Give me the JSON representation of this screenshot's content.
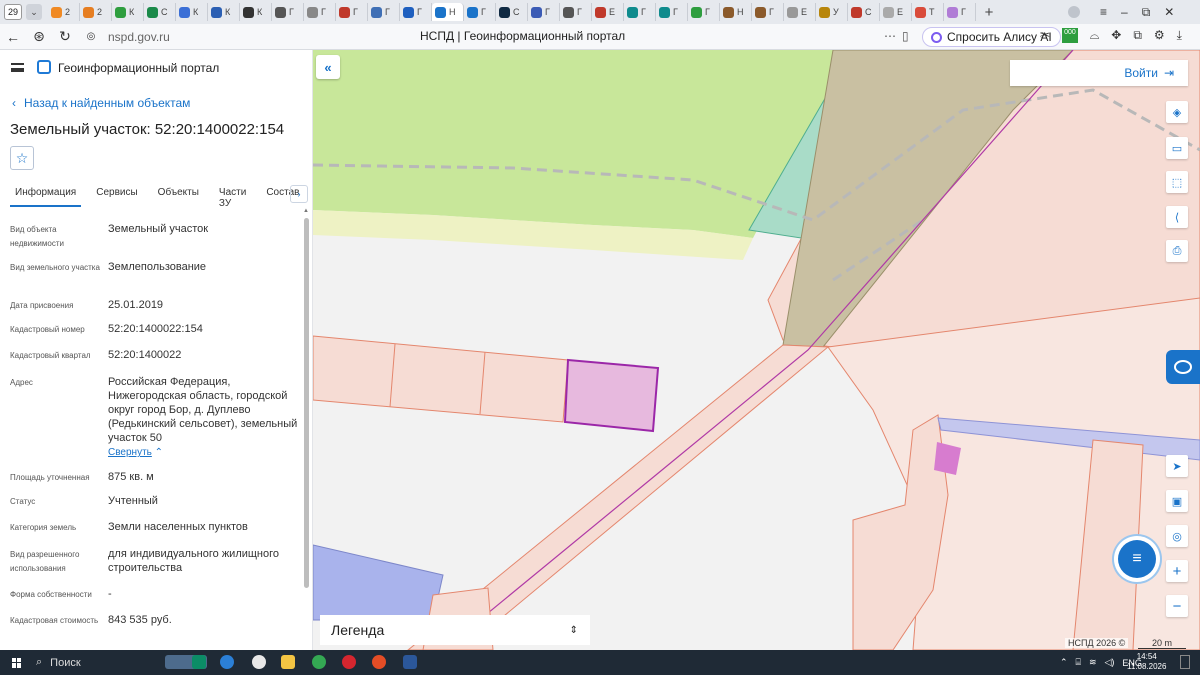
{
  "browser": {
    "tab_count": "29",
    "page_title": "НСПД | Геоинформационный портал",
    "url": "nspd.gov.ru",
    "alice_label": "Спросить Алису AI",
    "tabs": [
      {
        "fav": "#f08a24",
        "t": "2"
      },
      {
        "fav": "#e67e22",
        "t": "2"
      },
      {
        "fav": "#2e9e3f",
        "t": "К"
      },
      {
        "fav": "#1a8a4a",
        "t": "С"
      },
      {
        "fav": "#3b6fd6",
        "t": "К"
      },
      {
        "fav": "#2b5fb3",
        "t": "К"
      },
      {
        "fav": "#333",
        "t": "К"
      },
      {
        "fav": "#555",
        "t": "Г"
      },
      {
        "fav": "#888",
        "t": "Г"
      },
      {
        "fav": "#c0392b",
        "t": "Г"
      },
      {
        "fav": "#3f6fb5",
        "t": "Г"
      },
      {
        "fav": "#1e5fbf",
        "t": "Г"
      },
      {
        "fav": "#1a73c9",
        "t": "Н"
      },
      {
        "fav": "#1a73c9",
        "t": "Г"
      },
      {
        "fav": "#102a43",
        "t": "С"
      },
      {
        "fav": "#3b5bb5",
        "t": "Г"
      },
      {
        "fav": "#555",
        "t": "Г"
      },
      {
        "fav": "#c0392b",
        "t": "Е"
      },
      {
        "fav": "#0f8b8d",
        "t": "Г"
      },
      {
        "fav": "#0f8b8d",
        "t": "Г"
      },
      {
        "fav": "#2e9e3f",
        "t": "Г"
      },
      {
        "fav": "#8b5a2b",
        "t": "Н"
      },
      {
        "fav": "#8b5a2b",
        "t": "Г"
      },
      {
        "fav": "#999",
        "t": "Е"
      },
      {
        "fav": "#b8860b",
        "t": "У"
      },
      {
        "fav": "#c0392b",
        "t": "С"
      },
      {
        "fav": "#aaa",
        "t": "Е"
      },
      {
        "fav": "#d94b3a",
        "t": "Т"
      },
      {
        "fav": "#b07cd6",
        "t": "Г"
      }
    ]
  },
  "panel": {
    "app_title": "Геоинформационный портал",
    "back_label": "Назад к найденным объектам",
    "object_title": "Земельный участок: 52:20:1400022:154",
    "tabs": [
      "Информация",
      "Сервисы",
      "Объекты",
      "Части ЗУ",
      "Состав"
    ],
    "collapse_label": "Свернуть",
    "fields": [
      {
        "label": "Вид объекта недвижимости",
        "value": "Земельный участок"
      },
      {
        "label": "Вид земельного участка",
        "value": "Землепользование"
      },
      {
        "label": "Дата присвоения",
        "value": "25.01.2019"
      },
      {
        "label": "Кадастровый номер",
        "value": "52:20:1400022:154"
      },
      {
        "label": "Кадастровый квартал",
        "value": "52:20:1400022"
      },
      {
        "label": "Адрес",
        "value": "Российская Федерация, Нижегородская область, городской округ город Бор, д. Дуплево (Редькинский сельсовет), земельный участок 50"
      },
      {
        "label": "Площадь уточненная",
        "value": "875 кв. м"
      },
      {
        "label": "Статус",
        "value": "Учтенный"
      },
      {
        "label": "Категория земель",
        "value": "Земли населенных пунктов"
      },
      {
        "label": "Вид разрешенного использования",
        "value": "для индивидуального жилищного строительства"
      },
      {
        "label": "Форма собственности",
        "value": "-"
      },
      {
        "label": "Кадастровая стоимость",
        "value": "843 535 руб."
      }
    ]
  },
  "map": {
    "login_label": "Войти",
    "legend_label": "Легенда",
    "attribution": "НСПД 2026 ©",
    "scale_label": "20 m",
    "colors": {
      "selected_fill": "#e7b9de",
      "selected_stroke": "#9b27a8",
      "parcel_fill": "#f6dcd4",
      "parcel_stroke": "#e4866d",
      "green": "#c8e79a",
      "teal": "#a9dcc8",
      "blue": "#a9b3ec"
    }
  },
  "taskbar": {
    "search_label": "Поиск",
    "lang": "ENG",
    "time": "14:54",
    "date": "11.08.2026"
  }
}
